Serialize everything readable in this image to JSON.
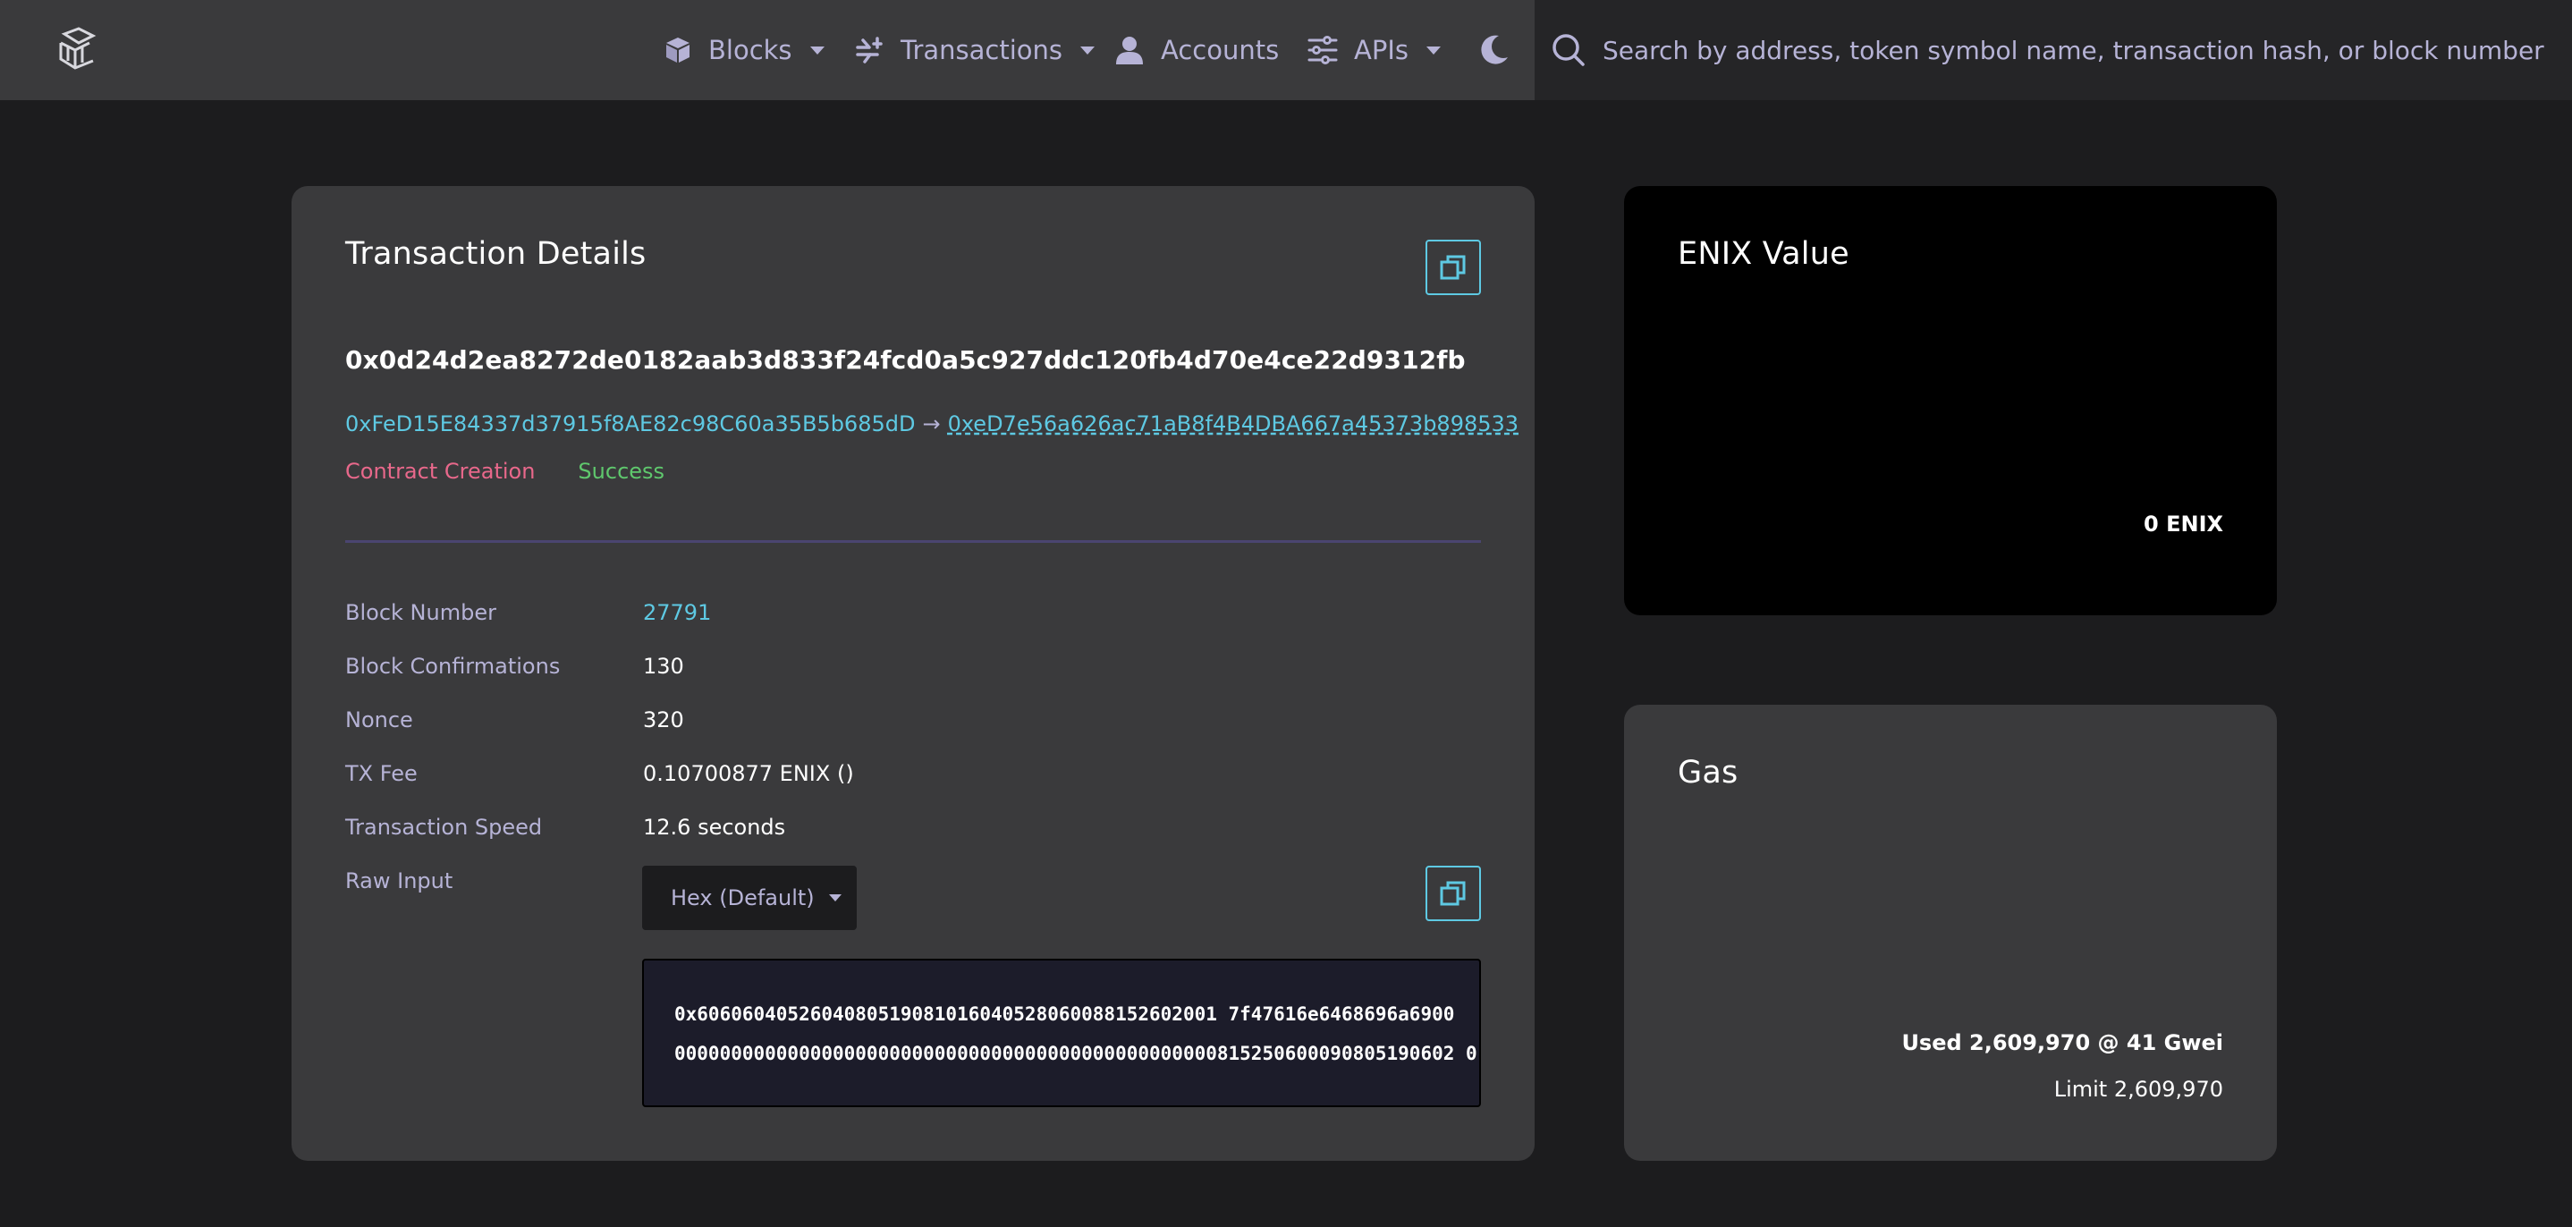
{
  "nav": {
    "items": [
      {
        "label": "Blocks",
        "icon": "cube-icon",
        "dropdown": true
      },
      {
        "label": "Transactions",
        "icon": "transfer-arrows-icon",
        "dropdown": true
      },
      {
        "label": "Accounts",
        "icon": "user-icon",
        "dropdown": false
      },
      {
        "label": "APIs",
        "icon": "sliders-icon",
        "dropdown": true
      }
    ],
    "theme_icon": "moon-icon"
  },
  "search": {
    "placeholder": "Search by address, token symbol name, transaction hash, or block number"
  },
  "transaction": {
    "title": "Transaction Details",
    "hash": "0x0d24d2ea8272de0182aab3d833f24fcd0a5c927ddc120fb4d70e4ce22d9312fb",
    "from": "0xFeD15E84337d37915f8AE82c98C60a35B5b685dD",
    "arrow": "→",
    "to": "0xeD7e56a626ac71aB8f4B4DBA667a45373b898533",
    "type_tag": "Contract Creation",
    "status": "Success",
    "details": [
      {
        "label": "Block Number",
        "value": "27791"
      },
      {
        "label": "Block Confirmations",
        "value": "130"
      },
      {
        "label": "Nonce",
        "value": "320"
      },
      {
        "label": "TX Fee",
        "value": "0.10700877 ENIX ()"
      },
      {
        "label": "Transaction Speed",
        "value": "12.6 seconds"
      },
      {
        "label": "Raw Input",
        "value": ""
      }
    ],
    "raw_input_format": "Hex (Default)",
    "raw_input_lines": [
      "0x6060604052604080519081016040528060088152602001 7f47616e6468696a6900",
      "000000000000000000000000000000000000000000000000815250600090805190602 0"
    ]
  },
  "enix": {
    "title": "ENIX Value",
    "value": "0 ENIX"
  },
  "gas": {
    "title": "Gas",
    "used": "Used 2,609,970 @ 41 Gwei",
    "limit": "Limit 2,609,970"
  },
  "colors": {
    "accent": "#5ec9e3",
    "nav_text": "#b6b3d6",
    "contract_creation": "#e8688b",
    "success": "#5fc86d"
  }
}
